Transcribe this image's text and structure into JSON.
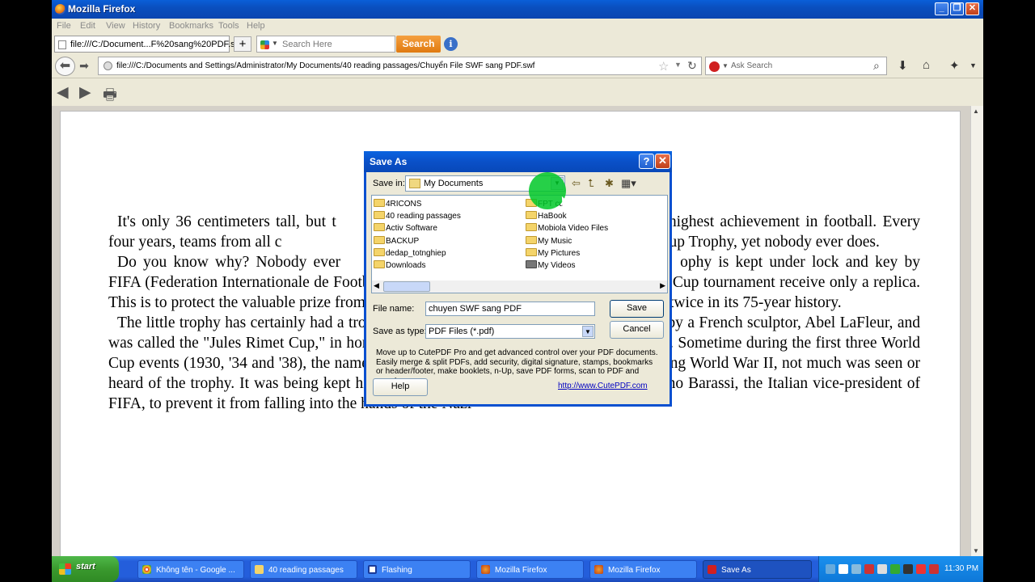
{
  "window": {
    "title": "Mozilla Firefox"
  },
  "menu": [
    "File",
    "Edit",
    "View",
    "History",
    "Bookmarks",
    "Tools",
    "Help"
  ],
  "tab": {
    "title": "file:///C:/Document...F%20sang%20PDF.swf"
  },
  "toolbar_search": {
    "placeholder": "Search Here",
    "button": "Search"
  },
  "url": "file:///C:/Documents and Settings/Administrator/My Documents/40 reading passages/Chuyển File SWF sang PDF.swf",
  "ask_search": {
    "placeholder": "Ask Search"
  },
  "article": {
    "paragraphs": [
      "It's only 36 centimeters tall, but t",
      "the highest achievement in football.",
      "Every four years, teams from all c",
      "FA World Cup Trophy, yet nobody",
      "ever does.",
      "Do you know why? Nobody ever",
      "ophy is kept under lock and key by",
      "FIFA (Federation Internationale de Football Association). The champions of each World Cup tournament receive only a replica. This is to protect the valuable prize from thieves, who have stolen the World Cup trophy twice in its 75-year history.",
      "The little trophy has certainly had a troubled existence. The original trophy was made by a French sculptor, Abel LaFleur, and was called the \"Jules Rimet Cup,\" in honor of the founder of the World Cup tournament. Sometime during the first three World Cup events (1930, '34 and '38), the name changed to simply the \"World Cup.\" Then during World War II, not much was seen or heard of the trophy. It was being kept hidden in a shoe box under the bed of Dr. Ottorino Barassi, the Italian vice-president of FIFA, to prevent it from falling into the hands of the Nazi"
    ]
  },
  "dialog": {
    "title": "Save As",
    "help_glyph": "?",
    "close_glyph": "✕",
    "save_in_label": "Save in:",
    "save_in_value": "My Documents",
    "folders_left": [
      "4RICONS",
      "40 reading passages",
      "Activ Software",
      "BACKUP",
      "dedap_totnghiep",
      "Downloads"
    ],
    "folders_right": [
      "FPT cus",
      "HaBook",
      "Mobiola Video Files",
      "My Music",
      "My Pictures",
      "My Videos"
    ],
    "file_name_label": "File name:",
    "file_name_value": "chuyen SWF sang PDF",
    "save_type_label": "Save as type:",
    "save_type_value": "PDF Files (*.pdf)",
    "save_button": "Save",
    "cancel_button": "Cancel",
    "info_text": "Move up to CutePDF Pro and get advanced control over your PDF documents. Easily merge & split PDFs, add security, digital signature, stamps, bookmarks or header/footer, make booklets, n-Up, save PDF forms, scan to PDF and more!",
    "help_button": "Help",
    "link": "http://www.CutePDF.com"
  },
  "taskbar": {
    "start": "start",
    "tasks": [
      "Không tên - Google ...",
      "40 reading passages",
      "Flashing",
      "Mozilla Firefox",
      "Mozilla Firefox",
      "Save As"
    ],
    "clock": "11:30 PM"
  }
}
